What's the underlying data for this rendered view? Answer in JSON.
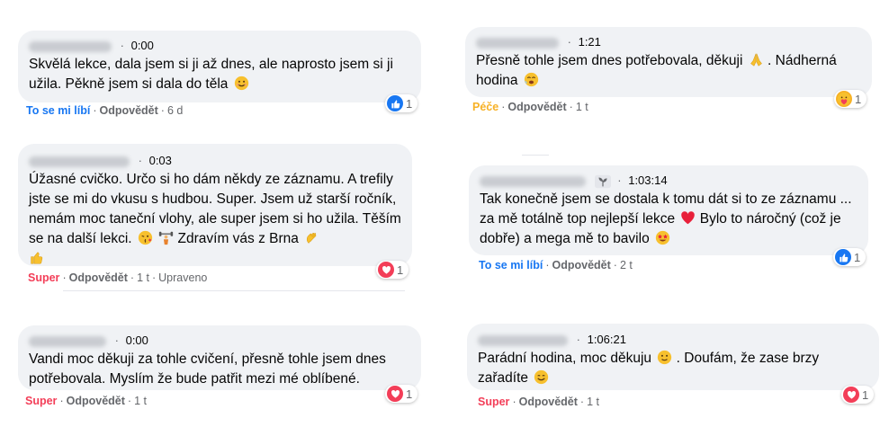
{
  "comments": [
    {
      "timestamp": "0:00",
      "text": "Skvělá lekce, dala jsem si ji až dnes, ale naprosto jsem si ji užila. Pěkně jsem si dala do těla",
      "reaction_count": "1",
      "reaction_icon": "like-icon",
      "action_reaction": "To se mi líbí",
      "action_reply": "Odpovědět",
      "age": "6 d",
      "edited": ""
    },
    {
      "timestamp": "0:03",
      "text": "Úžasné cvičko. Určo si ho dám někdy ze záznamu. A trefily jste se mi do vkusu s hudbou. Super. Jsem už starší ročník, nemám moc taneční vlohy, ale super jsem si ho užila. Těším se na další lekci.",
      "text_suffix": "Zdravím vás z Brna",
      "reaction_count": "1",
      "reaction_icon": "love-icon",
      "action_reaction": "Super",
      "action_reply": "Odpovědět",
      "age": "1 t",
      "edited": "Upraveno"
    },
    {
      "timestamp": "0:00",
      "text": "Vandi moc děkuji za tohle cvičení, přesně tohle jsem dnes potřebovala. Myslím že bude patřit mezi mé oblíbené.",
      "reaction_count": "1",
      "reaction_icon": "love-icon",
      "action_reaction": "Super",
      "action_reply": "Odpovědět",
      "age": "1 t",
      "edited": ""
    },
    {
      "timestamp": "1:21",
      "text": "Přesně tohle jsem dnes potřebovala, děkuji",
      "text_suffix": ". Nádherná hodina",
      "reaction_count": "1",
      "reaction_icon": "care-icon",
      "action_reaction": "Péče",
      "action_reply": "Odpovědět",
      "age": "1 t",
      "edited": ""
    },
    {
      "timestamp": "1:03:14",
      "text": "Tak konečně jsem se dostala k tomu dát si to ze záznamu ... za mě totálně top nejlepší lekce",
      "text_suffix": "Bylo to náročný (což je dobře) a mega mě to bavilo",
      "reaction_count": "1",
      "reaction_icon": "like-icon",
      "action_reaction": "To se mi líbí",
      "action_reply": "Odpovědět",
      "age": "2 t",
      "edited": ""
    },
    {
      "timestamp": "1:06:21",
      "text": "Parádní hodina, moc děkuju",
      "text_suffix": ". Doufám, že zase brzy zařadíte",
      "reaction_count": "1",
      "reaction_icon": "love-icon",
      "action_reaction": "Super",
      "action_reply": "Odpovědět",
      "age": "1 t",
      "edited": ""
    }
  ],
  "separator": "·",
  "colors": {
    "bubble": "#f0f2f5",
    "like": "#1877f2",
    "love": "#f33e58",
    "care": "#f7b125",
    "meta_gray": "#65676b"
  }
}
